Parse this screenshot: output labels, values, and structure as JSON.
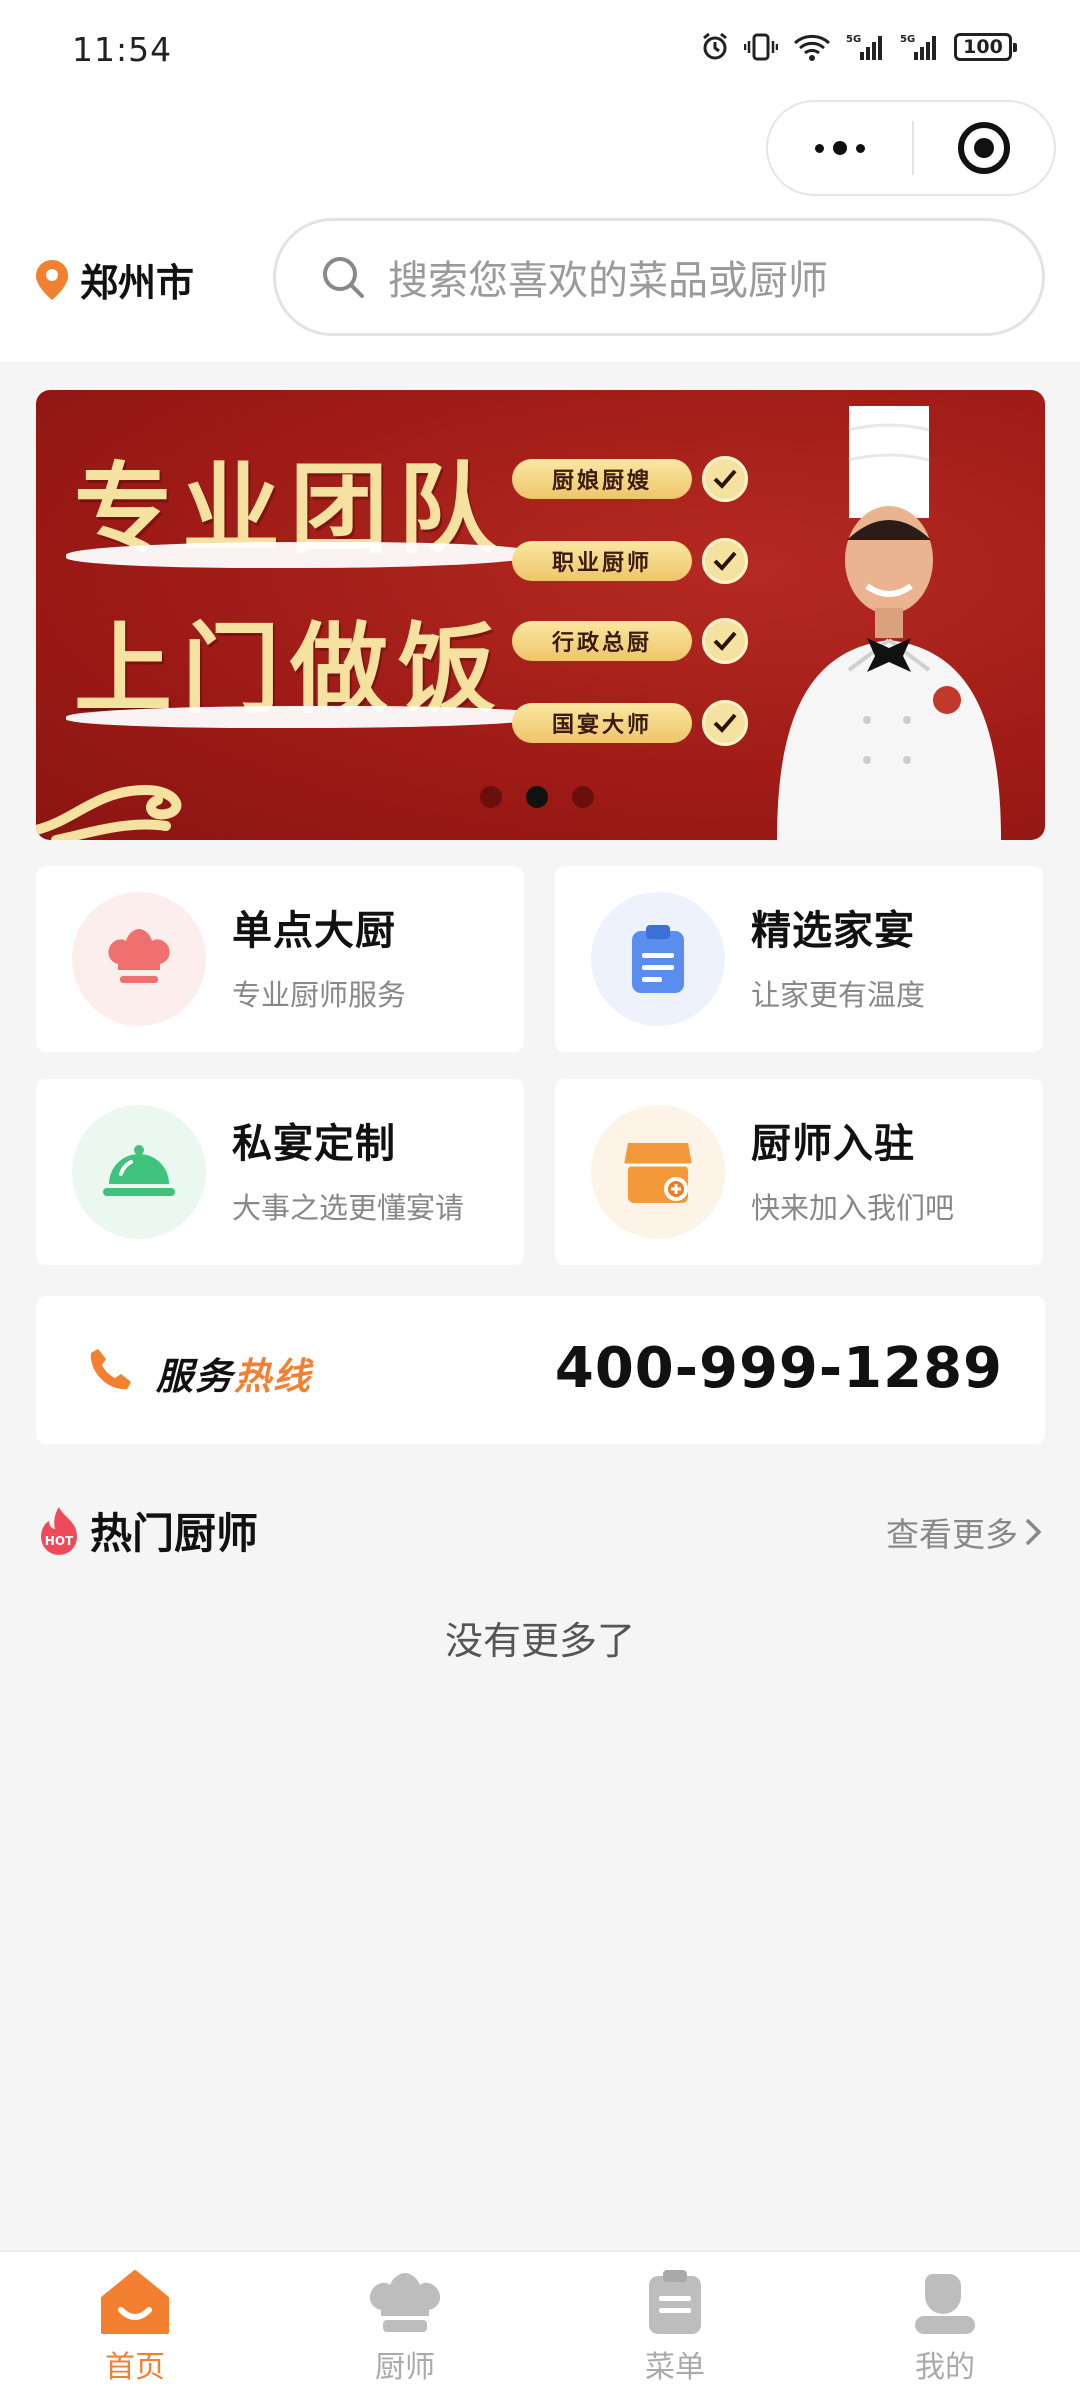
{
  "status_bar": {
    "time": "11:54",
    "battery": "100"
  },
  "header": {
    "city": "郑州市",
    "search_placeholder": "搜索您喜欢的菜品或厨师"
  },
  "banner": {
    "headline_1": "专业团队",
    "headline_2": "上门做饭",
    "tags": [
      "厨娘厨嫂",
      "职业厨师",
      "行政总厨",
      "国宴大师"
    ],
    "slides": 3,
    "active_slide": 2
  },
  "services": [
    {
      "title": "单点大厨",
      "subtitle": "专业厨师服务",
      "icon": "chef-hat-icon",
      "color": "#f07070",
      "bg": "#fdeeee"
    },
    {
      "title": "精选家宴",
      "subtitle": "让家更有温度",
      "icon": "clipboard-icon",
      "color": "#5b8def",
      "bg": "#edf2fd"
    },
    {
      "title": "私宴定制",
      "subtitle": "大事之选更懂宴请",
      "icon": "food-cloche-icon",
      "color": "#3fc27c",
      "bg": "#eaf8f0"
    },
    {
      "title": "厨师入驻",
      "subtitle": "快来加入我们吧",
      "icon": "shop-icon",
      "color": "#f3993a",
      "bg": "#fdf3e7"
    }
  ],
  "hotline": {
    "label_a": "服务",
    "label_b": "热线",
    "number": "400-999-1289"
  },
  "hot_chefs": {
    "title": "热门厨师",
    "hot_badge": "HOT",
    "more": "查看更多",
    "empty": "没有更多了"
  },
  "tabbar": [
    {
      "label": "首页",
      "icon": "home-icon",
      "active": true
    },
    {
      "label": "厨师",
      "icon": "chef-hat-icon",
      "active": false
    },
    {
      "label": "菜单",
      "icon": "menu-clipboard-icon",
      "active": false
    },
    {
      "label": "我的",
      "icon": "user-icon",
      "active": false
    }
  ],
  "colors": {
    "accent": "#f37f31",
    "banner_red": "#9d1a16",
    "banner_gold": "#f6e2a0"
  }
}
